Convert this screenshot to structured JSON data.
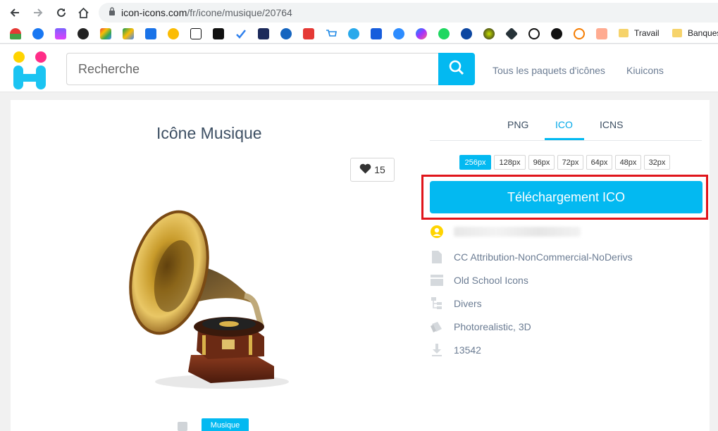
{
  "browser": {
    "url_host": "icon-icons.com",
    "url_path": "/fr/icone/musique/20764",
    "bookmark_folders": [
      "Travail",
      "Banques"
    ]
  },
  "site": {
    "search_placeholder": "Recherche",
    "nav_links": [
      "Tous les paquets d'icônes",
      "Kiuicons"
    ]
  },
  "icon": {
    "title": "Icône Musique",
    "likes": "15",
    "tag": "Musique"
  },
  "formats": {
    "tabs": [
      "PNG",
      "ICO",
      "ICNS"
    ],
    "active_tab": "ICO",
    "sizes": [
      "256px",
      "128px",
      "96px",
      "72px",
      "64px",
      "48px",
      "32px"
    ],
    "active_size": "256px",
    "download_label": "Téléchargement ICO"
  },
  "meta": {
    "license": "CC Attribution-NonCommercial-NoDerivs",
    "pack": "Old School Icons",
    "category": "Divers",
    "style": "Photorealistic, 3D",
    "downloads": "13542"
  },
  "colors": {
    "accent": "#03b9f1",
    "highlight": "#e0151b",
    "text_muted": "#6b7c93"
  }
}
